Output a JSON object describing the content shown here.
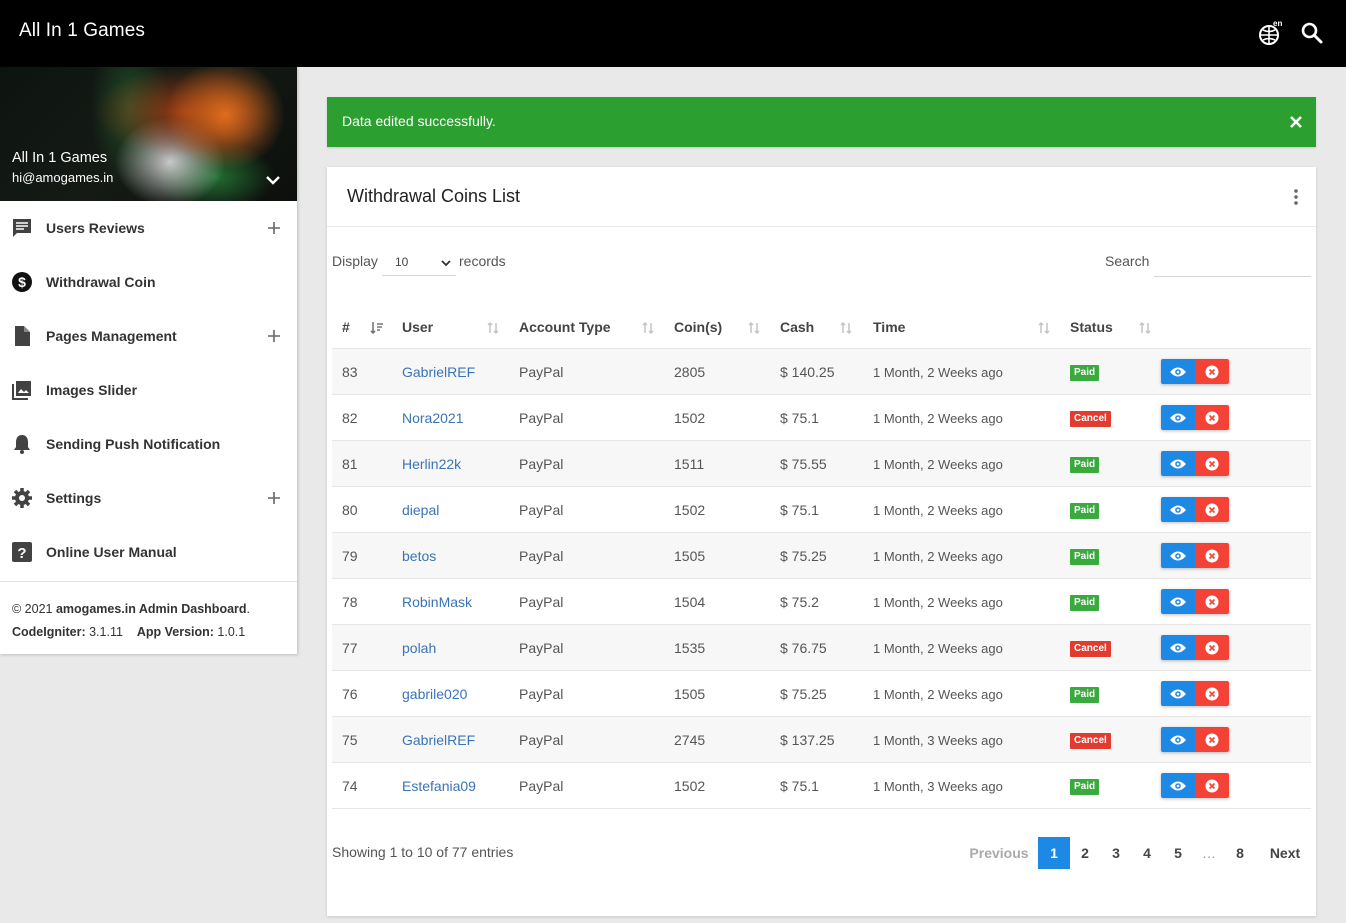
{
  "header": {
    "title": "All In 1 Games",
    "lang_badge": "en"
  },
  "sidebar": {
    "user_name": "All In 1 Games",
    "user_email": "hi@amogames.in",
    "items": [
      {
        "label": "Users Reviews",
        "icon": "comment-icon",
        "expandable": true
      },
      {
        "label": "Withdrawal Coin",
        "icon": "dollar-icon",
        "expandable": false
      },
      {
        "label": "Pages Management",
        "icon": "file-icon",
        "expandable": true
      },
      {
        "label": "Images Slider",
        "icon": "image-icon",
        "expandable": false
      },
      {
        "label": "Sending Push Notification",
        "icon": "bell-icon",
        "expandable": false
      },
      {
        "label": "Settings",
        "icon": "gear-icon",
        "expandable": true
      },
      {
        "label": "Online User Manual",
        "icon": "help-icon",
        "expandable": false
      }
    ],
    "footer": {
      "copyright": "© 2021",
      "brand": "amogames.in Admin Dashboard",
      "period": ".",
      "ci_label": "CodeIgniter:",
      "ci_version": "3.1.11",
      "app_label": "App Version:",
      "app_version": "1.0.1"
    }
  },
  "alert": {
    "text": "Data edited successfully."
  },
  "card": {
    "title": "Withdrawal Coins List",
    "display_label": "Display",
    "display_value": "10",
    "records_label": "records",
    "search_label": "Search",
    "search_value": ""
  },
  "table": {
    "headers": [
      "#",
      "User",
      "Account Type",
      "Coin(s)",
      "Cash",
      "Time",
      "Status"
    ],
    "rows": [
      {
        "id": "83",
        "user": "GabrielREF",
        "account": "PayPal",
        "coins": "2805",
        "cash": "$ 140.25",
        "time": "1 Month, 2 Weeks ago",
        "status": "Paid"
      },
      {
        "id": "82",
        "user": "Nora2021",
        "account": "PayPal",
        "coins": "1502",
        "cash": "$ 75.1",
        "time": "1 Month, 2 Weeks ago",
        "status": "Cancel"
      },
      {
        "id": "81",
        "user": "Herlin22k",
        "account": "PayPal",
        "coins": "1511",
        "cash": "$ 75.55",
        "time": "1 Month, 2 Weeks ago",
        "status": "Paid"
      },
      {
        "id": "80",
        "user": "diepal",
        "account": "PayPal",
        "coins": "1502",
        "cash": "$ 75.1",
        "time": "1 Month, 2 Weeks ago",
        "status": "Paid"
      },
      {
        "id": "79",
        "user": "betos",
        "account": "PayPal",
        "coins": "1505",
        "cash": "$ 75.25",
        "time": "1 Month, 2 Weeks ago",
        "status": "Paid"
      },
      {
        "id": "78",
        "user": "RobinMask",
        "account": "PayPal",
        "coins": "1504",
        "cash": "$ 75.2",
        "time": "1 Month, 2 Weeks ago",
        "status": "Paid"
      },
      {
        "id": "77",
        "user": "polah",
        "account": "PayPal",
        "coins": "1535",
        "cash": "$ 76.75",
        "time": "1 Month, 2 Weeks ago",
        "status": "Cancel"
      },
      {
        "id": "76",
        "user": "gabrile020",
        "account": "PayPal",
        "coins": "1505",
        "cash": "$ 75.25",
        "time": "1 Month, 2 Weeks ago",
        "status": "Paid"
      },
      {
        "id": "75",
        "user": "GabrielREF",
        "account": "PayPal",
        "coins": "2745",
        "cash": "$ 137.25",
        "time": "1 Month, 3 Weeks ago",
        "status": "Cancel"
      },
      {
        "id": "74",
        "user": "Estefania09",
        "account": "PayPal",
        "coins": "1502",
        "cash": "$ 75.1",
        "time": "1 Month, 3 Weeks ago",
        "status": "Paid"
      }
    ]
  },
  "footer": {
    "showing": "Showing 1 to 10 of 77 entries",
    "pagination": {
      "previous": "Previous",
      "pages": [
        "1",
        "2",
        "3",
        "4",
        "5",
        "…",
        "8"
      ],
      "active": "1",
      "next": "Next"
    }
  },
  "colors": {
    "accent": "#1e88e5",
    "success": "#2b9f2f",
    "paid": "#3aaa3e",
    "cancel": "#e23b30",
    "link": "#3a74b6"
  }
}
